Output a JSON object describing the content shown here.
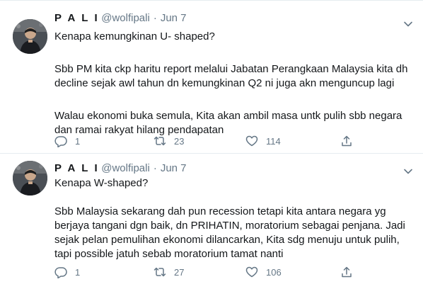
{
  "tweets": [
    {
      "name": "P A L I",
      "handle": "@wolfipali",
      "separator": "·",
      "date": "Jun 7",
      "paragraphs": [
        "Kenapa kemungkinan U- shaped?",
        "Sbb PM kita ckp haritu report melalui Jabatan Perangkaan Malaysia kita dh decline sejak awl tahun dn kemungkinan Q2 ni juga akn menguncup lagi",
        "Walau ekonomi buka semula, Kita akan ambil masa untk pulih sbb negara dan ramai rakyat hilang pendapatan"
      ],
      "replies": "1",
      "retweets": "23",
      "likes": "114"
    },
    {
      "name": "P A L I",
      "handle": "@wolfipali",
      "separator": "·",
      "date": "Jun 7",
      "paragraphs": [
        "Kenapa W-shaped?",
        "Sbb Malaysia sekarang dah pun recession tetapi kita antara negara yg berjaya tangani dgn baik, dn PRIHATIN, moratorium sebagai penjana. Jadi sejak pelan pemulihan ekonomi dilancarkan, Kita sdg menuju untuk pulih, tapi possible jatuh sebab moratorium tamat nanti"
      ],
      "replies": "1",
      "retweets": "27",
      "likes": "106"
    }
  ],
  "icons": {
    "reply": "reply-icon",
    "retweet": "retweet-icon",
    "like": "heart-icon",
    "share": "share-icon",
    "menu": "chevron-down-icon"
  },
  "colors": {
    "text": "#14171a",
    "muted": "#657786",
    "divider": "#e6ecf0"
  }
}
